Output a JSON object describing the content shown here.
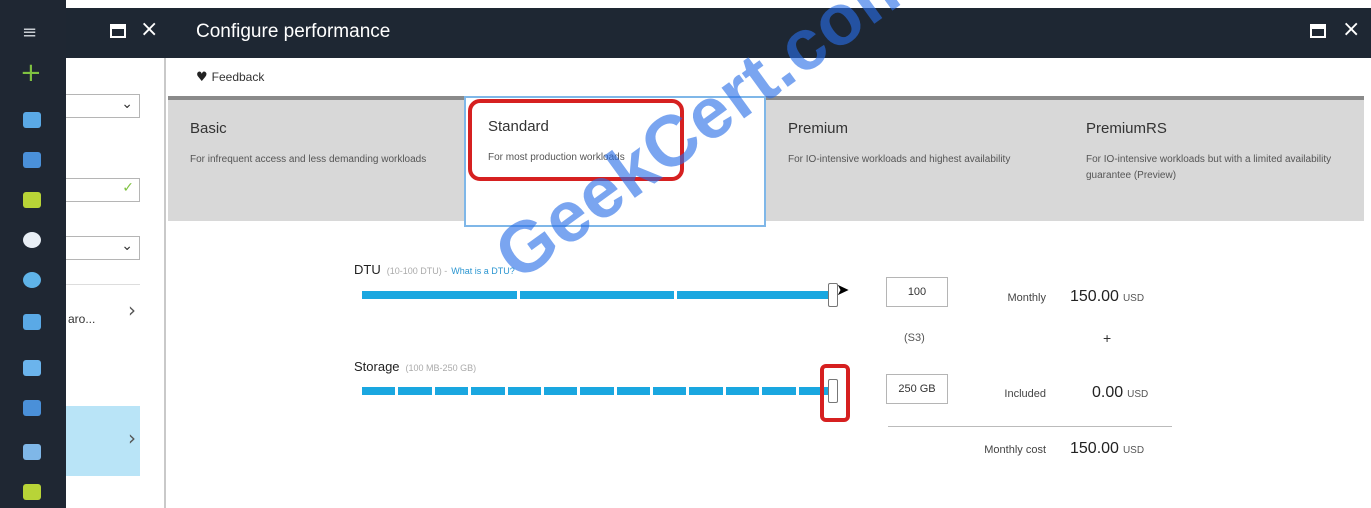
{
  "blade": {
    "title": "Configure performance"
  },
  "toolbar": {
    "feedback_label": "Feedback"
  },
  "left_blade": {
    "truncated_label": "aro..."
  },
  "tiers": [
    {
      "name": "Basic",
      "description": "For infrequent access and less demanding workloads",
      "selected": false
    },
    {
      "name": "Standard",
      "description": "For most production workloads",
      "selected": true
    },
    {
      "name": "Premium",
      "description": "For IO-intensive workloads and highest availability",
      "selected": false
    },
    {
      "name": "PremiumRS",
      "description": "For IO-intensive workloads but with a limited availability guarantee (Preview)",
      "selected": false
    }
  ],
  "dtu": {
    "label": "DTU",
    "range": "(10-100 DTU) -",
    "help_link": "What is a DTU?",
    "value": "100",
    "tier_code": "(S3)",
    "level": 1.0
  },
  "storage": {
    "label": "Storage",
    "range": "(100 MB-250 GB)",
    "value": "250 GB",
    "level": 1.0
  },
  "pricing": {
    "monthly_label": "Monthly",
    "monthly_value": "150.00",
    "plus": "+",
    "included_label": "Included",
    "included_value": "0.00",
    "total_label": "Monthly cost",
    "total_value": "150.00",
    "currency": "USD"
  },
  "watermark": "GeekCert.com",
  "colors": {
    "accent": "#1aa7e0",
    "highlight": "#d62020",
    "topbar": "#1e2733"
  },
  "rail_icons": [
    "menu-icon",
    "plus-icon",
    "dashboard-icon",
    "resource-group-icon",
    "all-resources-icon",
    "recent-icon",
    "app-services-icon",
    "virtual-machines-icon",
    "cloud-services-icon",
    "sql-database-icon",
    "storage-icon",
    "security-icon"
  ]
}
